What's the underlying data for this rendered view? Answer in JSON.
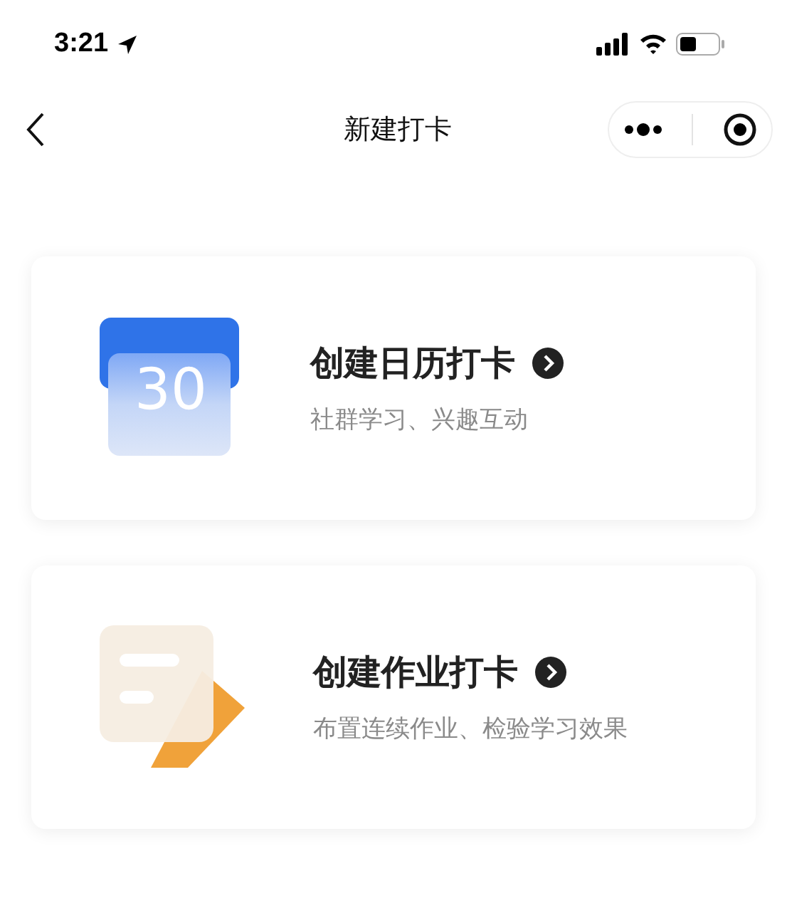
{
  "status_bar": {
    "time": "3:21"
  },
  "nav": {
    "title": "新建打卡"
  },
  "cards": [
    {
      "kind": "calendar",
      "icon_text": "30",
      "title": "创建日历打卡",
      "subtitle": "社群学习、兴趣互动"
    },
    {
      "kind": "homework",
      "title": "创建作业打卡",
      "subtitle": "布置连续作业、检验学习效果"
    }
  ]
}
